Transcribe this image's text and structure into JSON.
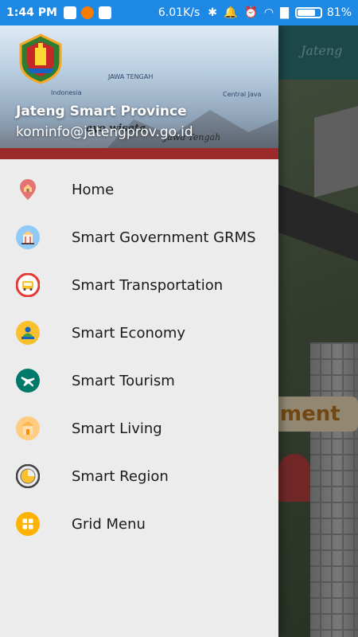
{
  "status_bar": {
    "time": "1:44 PM",
    "speed": "6.01K/s",
    "battery": "81%",
    "battery_level": 0.81
  },
  "drawer": {
    "header": {
      "title": "Jateng Smart Province",
      "email": "kominfo@jatengprov.go.id",
      "slogan": "ayo wisata",
      "slogan_sub": "Jawa Tengah",
      "brand_left": "Indonesia",
      "brand_center": "JAWA TENGAH",
      "brand_right": "Central Java"
    },
    "menu": [
      {
        "label": "Home",
        "icon": "home-pin-icon",
        "color": "#e57373"
      },
      {
        "label": "Smart Government GRMS",
        "icon": "government-building-icon",
        "color": "#64b5f6"
      },
      {
        "label": "Smart Transportation",
        "icon": "bus-icon",
        "color": "#e53935"
      },
      {
        "label": "Smart Economy",
        "icon": "economy-icon",
        "color": "#fbc02d"
      },
      {
        "label": "Smart Tourism",
        "icon": "airplane-icon",
        "color": "#00796b"
      },
      {
        "label": "Smart Living",
        "icon": "house-icon",
        "color": "#ffb74d"
      },
      {
        "label": "Smart Region",
        "icon": "region-globe-icon",
        "color": "#424242"
      },
      {
        "label": "Grid Menu",
        "icon": "grid-icon",
        "color": "#ffb300"
      }
    ]
  },
  "background_app": {
    "toolbar_logo": "Jateng",
    "banner_text": "ment"
  }
}
